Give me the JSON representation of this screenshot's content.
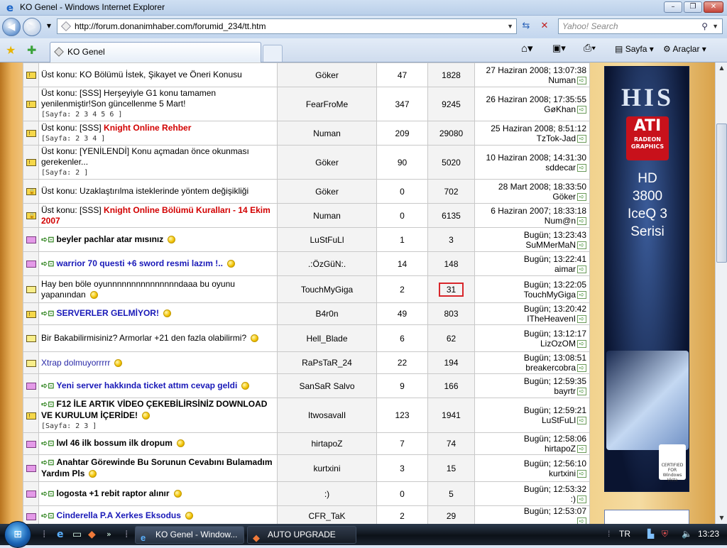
{
  "window": {
    "title": "KO Genel - Windows Internet Explorer",
    "minimize": "–",
    "maximize": "❐",
    "close": "✕"
  },
  "address": {
    "url": "http://forum.donanimhaber.com/forumid_234/tt.htm",
    "search_placeholder": "Yahoo! Search"
  },
  "tab": {
    "label": "KO Genel"
  },
  "toolbar": {
    "page": "Sayfa",
    "tools": "Araçlar"
  },
  "topics": [
    {
      "icon": "sticky",
      "title": "Üst konu: KO Bölümü İstek, Şikayet ve Öneri Konusu",
      "title_class": "",
      "pages": "",
      "author": "Göker",
      "replies": "47",
      "views": "1828",
      "date": "27 Haziran 2008; 13:07:38",
      "last": "Numan"
    },
    {
      "icon": "sticky",
      "title": "Üst konu: [SSS] Herşeyiyle G1 konu tamamen yenilenmiştir!Son güncellenme 5 Mart!",
      "title_class": "",
      "pages": "[Sayfa: 2 3 4 5 6 ]",
      "author": "FearFroMe",
      "replies": "347",
      "views": "9245",
      "date": "26 Haziran 2008; 17:35:55",
      "last": "GøKhan"
    },
    {
      "icon": "sticky",
      "prefix": "Üst konu: [SSS] ",
      "title": "Knight Online Rehber",
      "title_class": "red",
      "pages": "[Sayfa: 2 3 4 ]",
      "author": "Numan",
      "replies": "209",
      "views": "29080",
      "date": "25 Haziran 2008; 8:51:12",
      "last": "TzTok-Jad"
    },
    {
      "icon": "sticky",
      "title": "Üst konu: [YENİLENDİ] Konu açmadan önce okunması gerekenler...",
      "title_class": "",
      "pages": "[Sayfa: 2 ]",
      "author": "Göker",
      "replies": "90",
      "views": "5020",
      "date": "10 Haziran 2008; 14:31:30",
      "last": "sddecar"
    },
    {
      "icon": "locked",
      "title": "Üst konu: Uzaklaştırılma isteklerinde yöntem değişikliği",
      "title_class": "",
      "pages": "",
      "author": "Göker",
      "replies": "0",
      "views": "702",
      "date": "28 Mart 2008; 18:33:50",
      "last": "Göker"
    },
    {
      "icon": "locked",
      "prefix": "Üst konu: [SSS] ",
      "title": "Knight Online Bölümü Kuralları - 14 Ekim 2007",
      "title_class": "red",
      "pages": "",
      "author": "Numan",
      "replies": "0",
      "views": "6135",
      "date": "6 Haziran 2007; 18:33:18",
      "last": "Num@n"
    },
    {
      "icon": "pink",
      "arrow": true,
      "title": "beyler pachlar atar mısınız",
      "title_class": "bold",
      "coin": true,
      "author": "LuStFuLl",
      "replies": "1",
      "views": "3",
      "date": "Bugün; 13:23:43",
      "last": "SuMMerMaN"
    },
    {
      "icon": "pink",
      "arrow": true,
      "title": "warrior 70 questi +6 sword resmi lazım !..",
      "title_class": "blue",
      "coin": true,
      "author": ".:ÖzGüN:.",
      "replies": "14",
      "views": "148",
      "date": "Bugün; 13:22:41",
      "last": "aimar"
    },
    {
      "icon": "yel",
      "title": "Hay ben böle oyunnnnnnnnnnnnnnndaaa bu oyunu yapanından",
      "title_class": "",
      "coin": true,
      "author": "TouchMyGiga",
      "replies": "2",
      "views": "31",
      "highlight": true,
      "date": "Bugün; 13:22:05",
      "last": "TouchMyGiga"
    },
    {
      "icon": "sticky",
      "arrow": true,
      "title": "SERVERLER GELMİYOR!",
      "title_class": "blue",
      "coin": true,
      "author": "B4r0n",
      "replies": "49",
      "views": "803",
      "date": "Bugün; 13:20:42",
      "last": "ITheHeavenI"
    },
    {
      "icon": "yel",
      "title": "Bir Bakabilirmisiniz? Armorlar +21 den fazla olabilirmi?",
      "title_class": "",
      "coin": true,
      "author": "Hell_Blade",
      "replies": "6",
      "views": "62",
      "date": "Bugün; 13:12:17",
      "last": "LizOzOM"
    },
    {
      "icon": "yel",
      "title": "Xtrap dolmuyorrrrr",
      "title_class": "blue2",
      "coin": true,
      "author": "RaPsTaR_24",
      "replies": "22",
      "views": "194",
      "date": "Bugün; 13:08:51",
      "last": "breakercobra"
    },
    {
      "icon": "pink",
      "arrow": true,
      "title": "Yeni server hakkında ticket attım cevap geldi",
      "title_class": "blue",
      "coin": true,
      "author": "SanSaR Salvo",
      "replies": "9",
      "views": "166",
      "date": "Bugün; 12:59:35",
      "last": "bayrtr"
    },
    {
      "icon": "sticky",
      "arrow": true,
      "title": "F12 İLE ARTIK VİDEO ÇEKEBİLİRSİNİZ DOWNLOAD VE KURULUM İÇERİDE!",
      "title_class": "bold",
      "coin": true,
      "pages": "[Sayfa: 2 3 ]",
      "author": "ItwosavalI",
      "replies": "123",
      "views": "1941",
      "date": "Bugün; 12:59:21",
      "last": "LuStFuLl"
    },
    {
      "icon": "pink",
      "arrow": true,
      "title": "lwl 46 ilk bossum ilk dropum",
      "title_class": "bold",
      "coin": true,
      "author": "hirtapoZ",
      "replies": "7",
      "views": "74",
      "date": "Bugün; 12:58:06",
      "last": "hirtapoZ"
    },
    {
      "icon": "pink",
      "arrow": true,
      "title": "Anahtar Görewinde Bu Sorunun Cevabını Bulamadım Yardım Pls",
      "title_class": "bold",
      "coin": true,
      "author": "kurtxini",
      "replies": "3",
      "views": "15",
      "date": "Bugün; 12:56:10",
      "last": "kurtxini"
    },
    {
      "icon": "pink",
      "arrow": true,
      "title": "logosta +1 rebit raptor alınır",
      "title_class": "bold",
      "coin": true,
      "author": ":)",
      "replies": "0",
      "views": "5",
      "date": "Bugün; 12:53:32",
      "last": ":)"
    },
    {
      "icon": "pink",
      "arrow": true,
      "title": "Cinderella P.A Xerkes Eksodus",
      "title_class": "blue",
      "coin": true,
      "author": "CFR_TaK",
      "replies": "2",
      "views": "29",
      "date": "Bugün; 12:53:07",
      "last": ""
    }
  ],
  "ad": {
    "brand": "HIS",
    "chip": "ATI",
    "chip_sub": "RADEON",
    "chip_sub2": "GRAPHICS",
    "line1": "HD",
    "line2": "3800",
    "line3": "IceQ 3",
    "line4": "Serisi",
    "vista": "CERTIFIED FOR Windows Vista"
  },
  "taskbar": {
    "ie_task": "KO Genel - Window...",
    "upgrade_task": "AUTO UPGRADE",
    "lang": "TR",
    "time": "13:23"
  }
}
